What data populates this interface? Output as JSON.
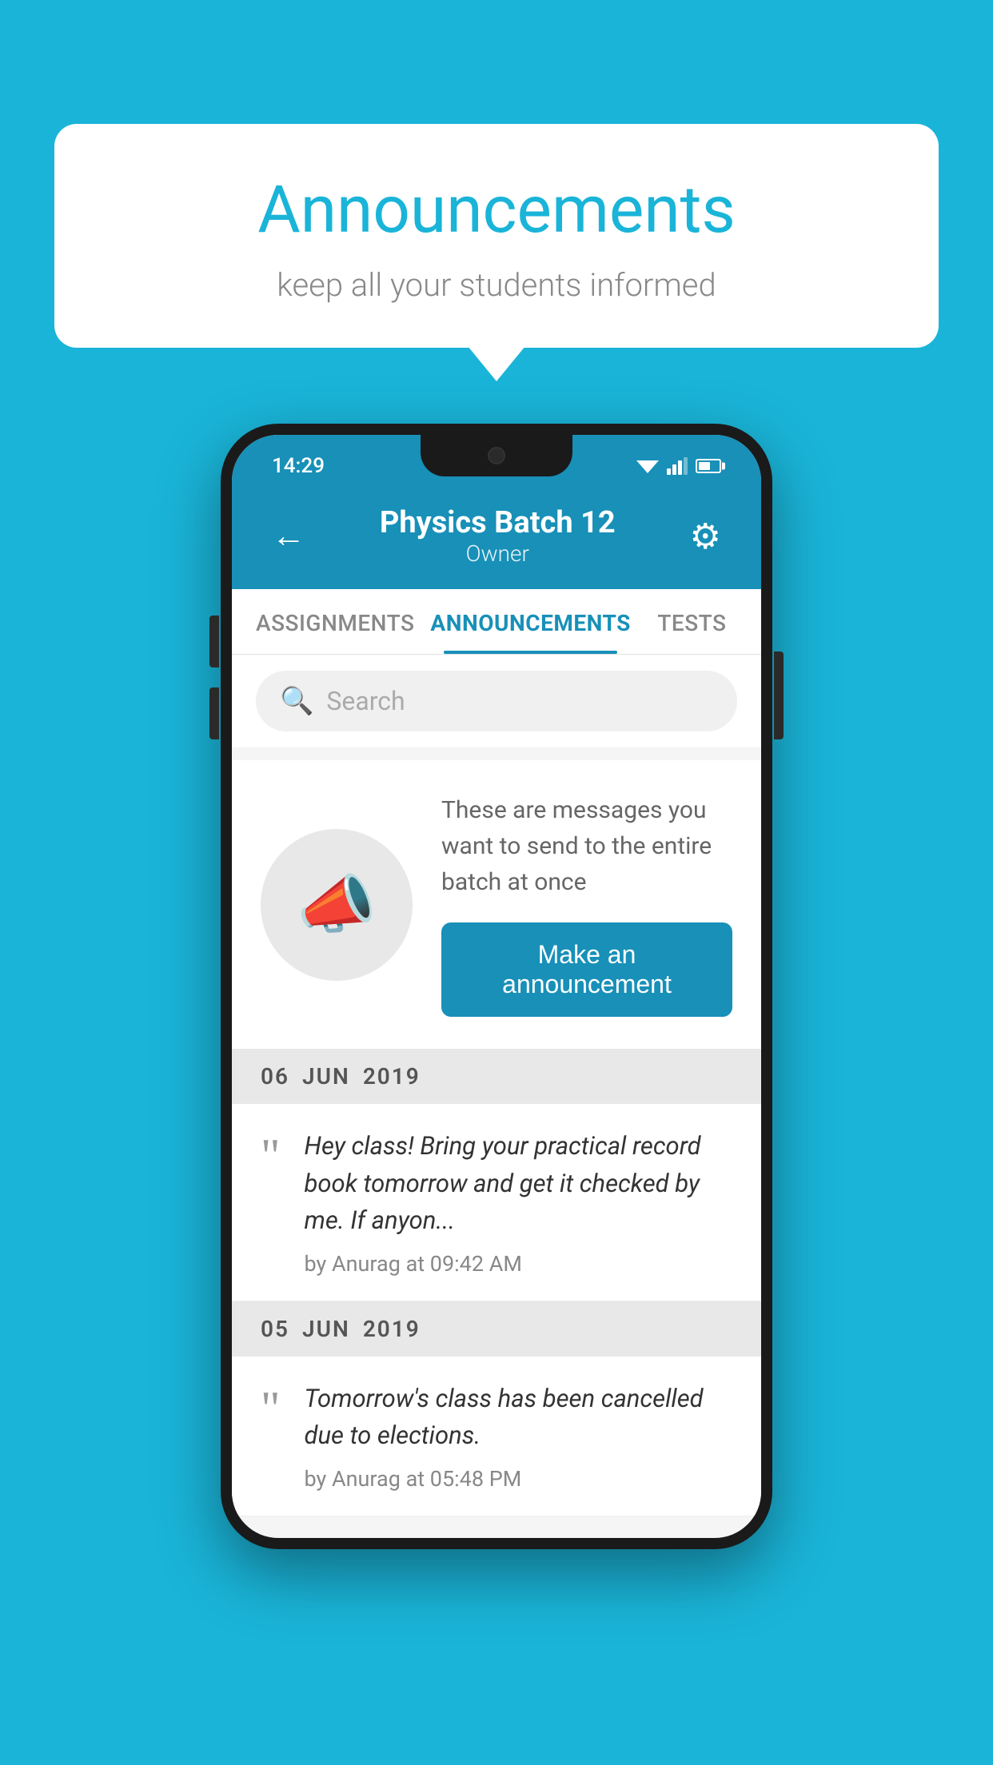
{
  "bubble": {
    "title": "Announcements",
    "subtitle": "keep all your students informed"
  },
  "phone": {
    "status_bar": {
      "time": "14:29"
    },
    "header": {
      "batch_name": "Physics Batch 12",
      "role": "Owner",
      "back_label": "←",
      "gear_label": "⚙"
    },
    "tabs": [
      {
        "label": "ASSIGNMENTS",
        "active": false
      },
      {
        "label": "ANNOUNCEMENTS",
        "active": true
      },
      {
        "label": "TESTS",
        "active": false
      }
    ],
    "search": {
      "placeholder": "Search"
    },
    "announcement_prompt": {
      "message": "These are messages you want to send to the entire batch at once",
      "button_label": "Make an announcement"
    },
    "dates": [
      {
        "date_parts": [
          "06",
          "JUN",
          "2019"
        ],
        "items": [
          {
            "text": "Hey class! Bring your practical record book tomorrow and get it checked by me. If anyon...",
            "meta": "by Anurag at 09:42 AM"
          }
        ]
      },
      {
        "date_parts": [
          "05",
          "JUN",
          "2019"
        ],
        "items": [
          {
            "text": "Tomorrow's class has been cancelled due to elections.",
            "meta": "by Anurag at 05:48 PM"
          }
        ]
      }
    ]
  }
}
